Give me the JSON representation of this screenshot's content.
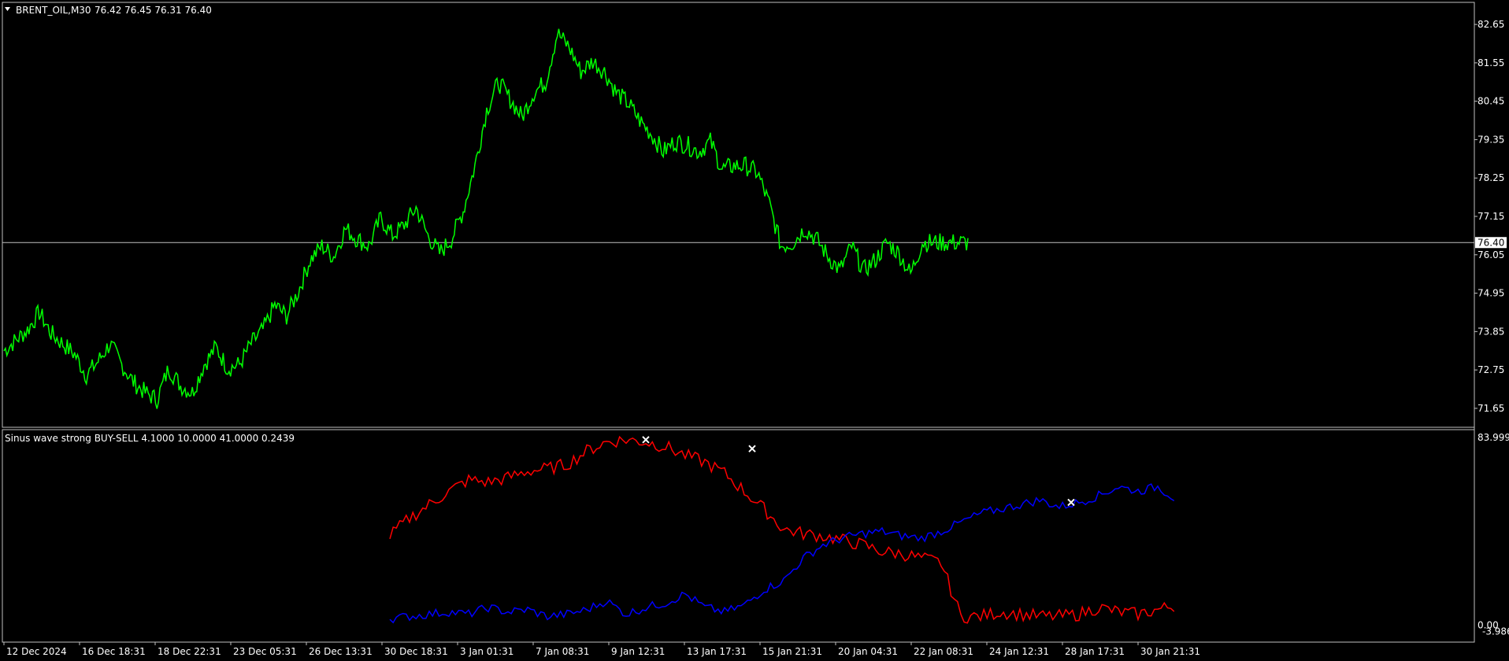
{
  "header": {
    "symbol_label": "BRENT_OIL,M30",
    "ohlc": "76.42 76.45 76.31 76.40"
  },
  "indicator": {
    "label": "Sinus wave strong BUY-SELL 4.1000 10.0000 41.0000 0.2439"
  },
  "colors": {
    "background": "#000000",
    "price": "#00ff00",
    "sell": "#ff0000",
    "buy": "#0000ff",
    "grid": "#c0c0c0",
    "marker": "#ffffff"
  },
  "icons": [
    "dropdown-triangle-icon"
  ],
  "chart_data": [
    {
      "type": "line",
      "name": "price",
      "title": "BRENT_OIL,M30",
      "y_ticks": [
        "82.65",
        "81.55",
        "80.45",
        "79.35",
        "78.25",
        "77.15",
        "76.05",
        "74.95",
        "73.85",
        "72.75",
        "71.65"
      ],
      "ylim": [
        71.4,
        82.9
      ],
      "current_price_label": "76.40",
      "current_price": 76.4,
      "x_ticks": [
        "12 Dec 2024",
        "16 Dec 18:31",
        "18 Dec 22:31",
        "23 Dec 05:31",
        "26 Dec 13:31",
        "30 Dec 18:31",
        "3 Jan 01:31",
        "7 Jan 08:31",
        "9 Jan 12:31",
        "13 Jan 17:31",
        "15 Jan 21:31",
        "20 Jan 04:31",
        "22 Jan 08:31",
        "24 Jan 12:31",
        "28 Jan 17:31",
        "30 Jan 21:31"
      ],
      "x": [
        0,
        3,
        6,
        9,
        12,
        15,
        18,
        21,
        24,
        27,
        30,
        33,
        36,
        39,
        42,
        45,
        48,
        51,
        54,
        57,
        60,
        63,
        66,
        69,
        72,
        75,
        78,
        81,
        84,
        87,
        90,
        93,
        96,
        99,
        102,
        105,
        108,
        111,
        114,
        117,
        120,
        123,
        126,
        129,
        132,
        135,
        138,
        141,
        144,
        147,
        150,
        153,
        156,
        159,
        162,
        165,
        168,
        171,
        174,
        177,
        180,
        183,
        186,
        189,
        192,
        195,
        198,
        201,
        204,
        207,
        210,
        213,
        216,
        219,
        222,
        225,
        228,
        231,
        234,
        237,
        240,
        243,
        246,
        249,
        252,
        255,
        258,
        261,
        264,
        267,
        270,
        273,
        276,
        279,
        282,
        285,
        288,
        291,
        294,
        297,
        300
      ],
      "values": [
        73.3,
        73.6,
        73.9,
        74.4,
        73.8,
        73.5,
        73.2,
        72.6,
        73.0,
        73.5,
        72.9,
        72.4,
        72.1,
        71.9,
        72.8,
        72.3,
        72.1,
        72.9,
        73.4,
        72.8,
        72.9,
        73.5,
        73.9,
        74.6,
        74.3,
        75.0,
        75.9,
        76.3,
        76.0,
        76.8,
        76.5,
        76.3,
        77.1,
        76.6,
        76.9,
        77.4,
        76.6,
        76.1,
        76.5,
        77.3,
        78.6,
        80.2,
        81.0,
        80.5,
        80.0,
        80.7,
        81.0,
        82.4,
        82.0,
        81.3,
        81.6,
        81.3,
        80.7,
        80.4,
        79.9,
        79.5,
        79.0,
        79.3,
        79.2,
        79.0,
        79.3,
        78.5,
        78.6,
        78.6,
        78.4,
        77.5,
        76.3,
        76.4,
        76.8,
        76.5,
        76.0,
        75.6,
        76.3,
        75.6,
        75.9,
        76.4,
        76.1,
        75.5,
        76.4,
        76.4,
        76.4,
        76.4,
        76.4,
        76.4,
        76.4,
        76.4,
        76.4,
        76.4,
        76.4,
        76.4,
        76.4,
        76.4,
        76.4,
        76.4,
        76.4,
        76.4,
        76.4,
        76.4,
        76.4,
        76.4,
        76.4
      ]
    },
    {
      "type": "line",
      "name": "Sinus wave strong BUY-SELL",
      "y_ticks": [
        "83.9994",
        "0.00"
      ],
      "y_min_label": "-3.9869",
      "ylim": [
        -3.9869,
        83.9994
      ],
      "x": [
        100,
        105,
        110,
        115,
        120,
        125,
        130,
        135,
        140,
        145,
        150,
        155,
        160,
        165,
        170,
        175,
        180,
        185,
        190,
        195,
        200,
        205,
        210,
        215,
        220,
        225,
        230,
        235,
        240,
        245,
        250,
        255,
        260,
        265,
        270,
        275,
        280,
        285,
        290,
        295,
        300
      ],
      "series": [
        {
          "name": "red-line",
          "color": "#ff0000",
          "values": [
            40,
            48,
            54,
            60,
            65,
            64,
            66,
            69,
            70,
            72,
            78,
            82,
            83,
            82,
            80,
            76,
            73,
            68,
            60,
            52,
            43,
            41,
            40,
            38,
            36,
            33,
            32,
            30,
            28,
            4,
            4,
            6,
            5,
            4,
            4,
            5,
            8,
            6,
            5,
            7,
            9
          ]
        },
        {
          "name": "blue-line",
          "color": "#0000ff",
          "values": [
            3,
            4,
            5,
            6,
            5,
            8,
            6,
            7,
            4,
            5,
            7,
            11,
            5,
            8,
            10,
            14,
            8,
            6,
            9,
            16,
            20,
            30,
            36,
            39,
            41,
            42,
            40,
            39,
            42,
            46,
            50,
            52,
            54,
            56,
            53,
            55,
            58,
            62,
            60,
            62,
            56
          ]
        }
      ],
      "markers": [
        {
          "x": 165,
          "y": 83
        },
        {
          "x": 192,
          "y": 79
        },
        {
          "x": 273,
          "y": 55
        }
      ]
    }
  ]
}
